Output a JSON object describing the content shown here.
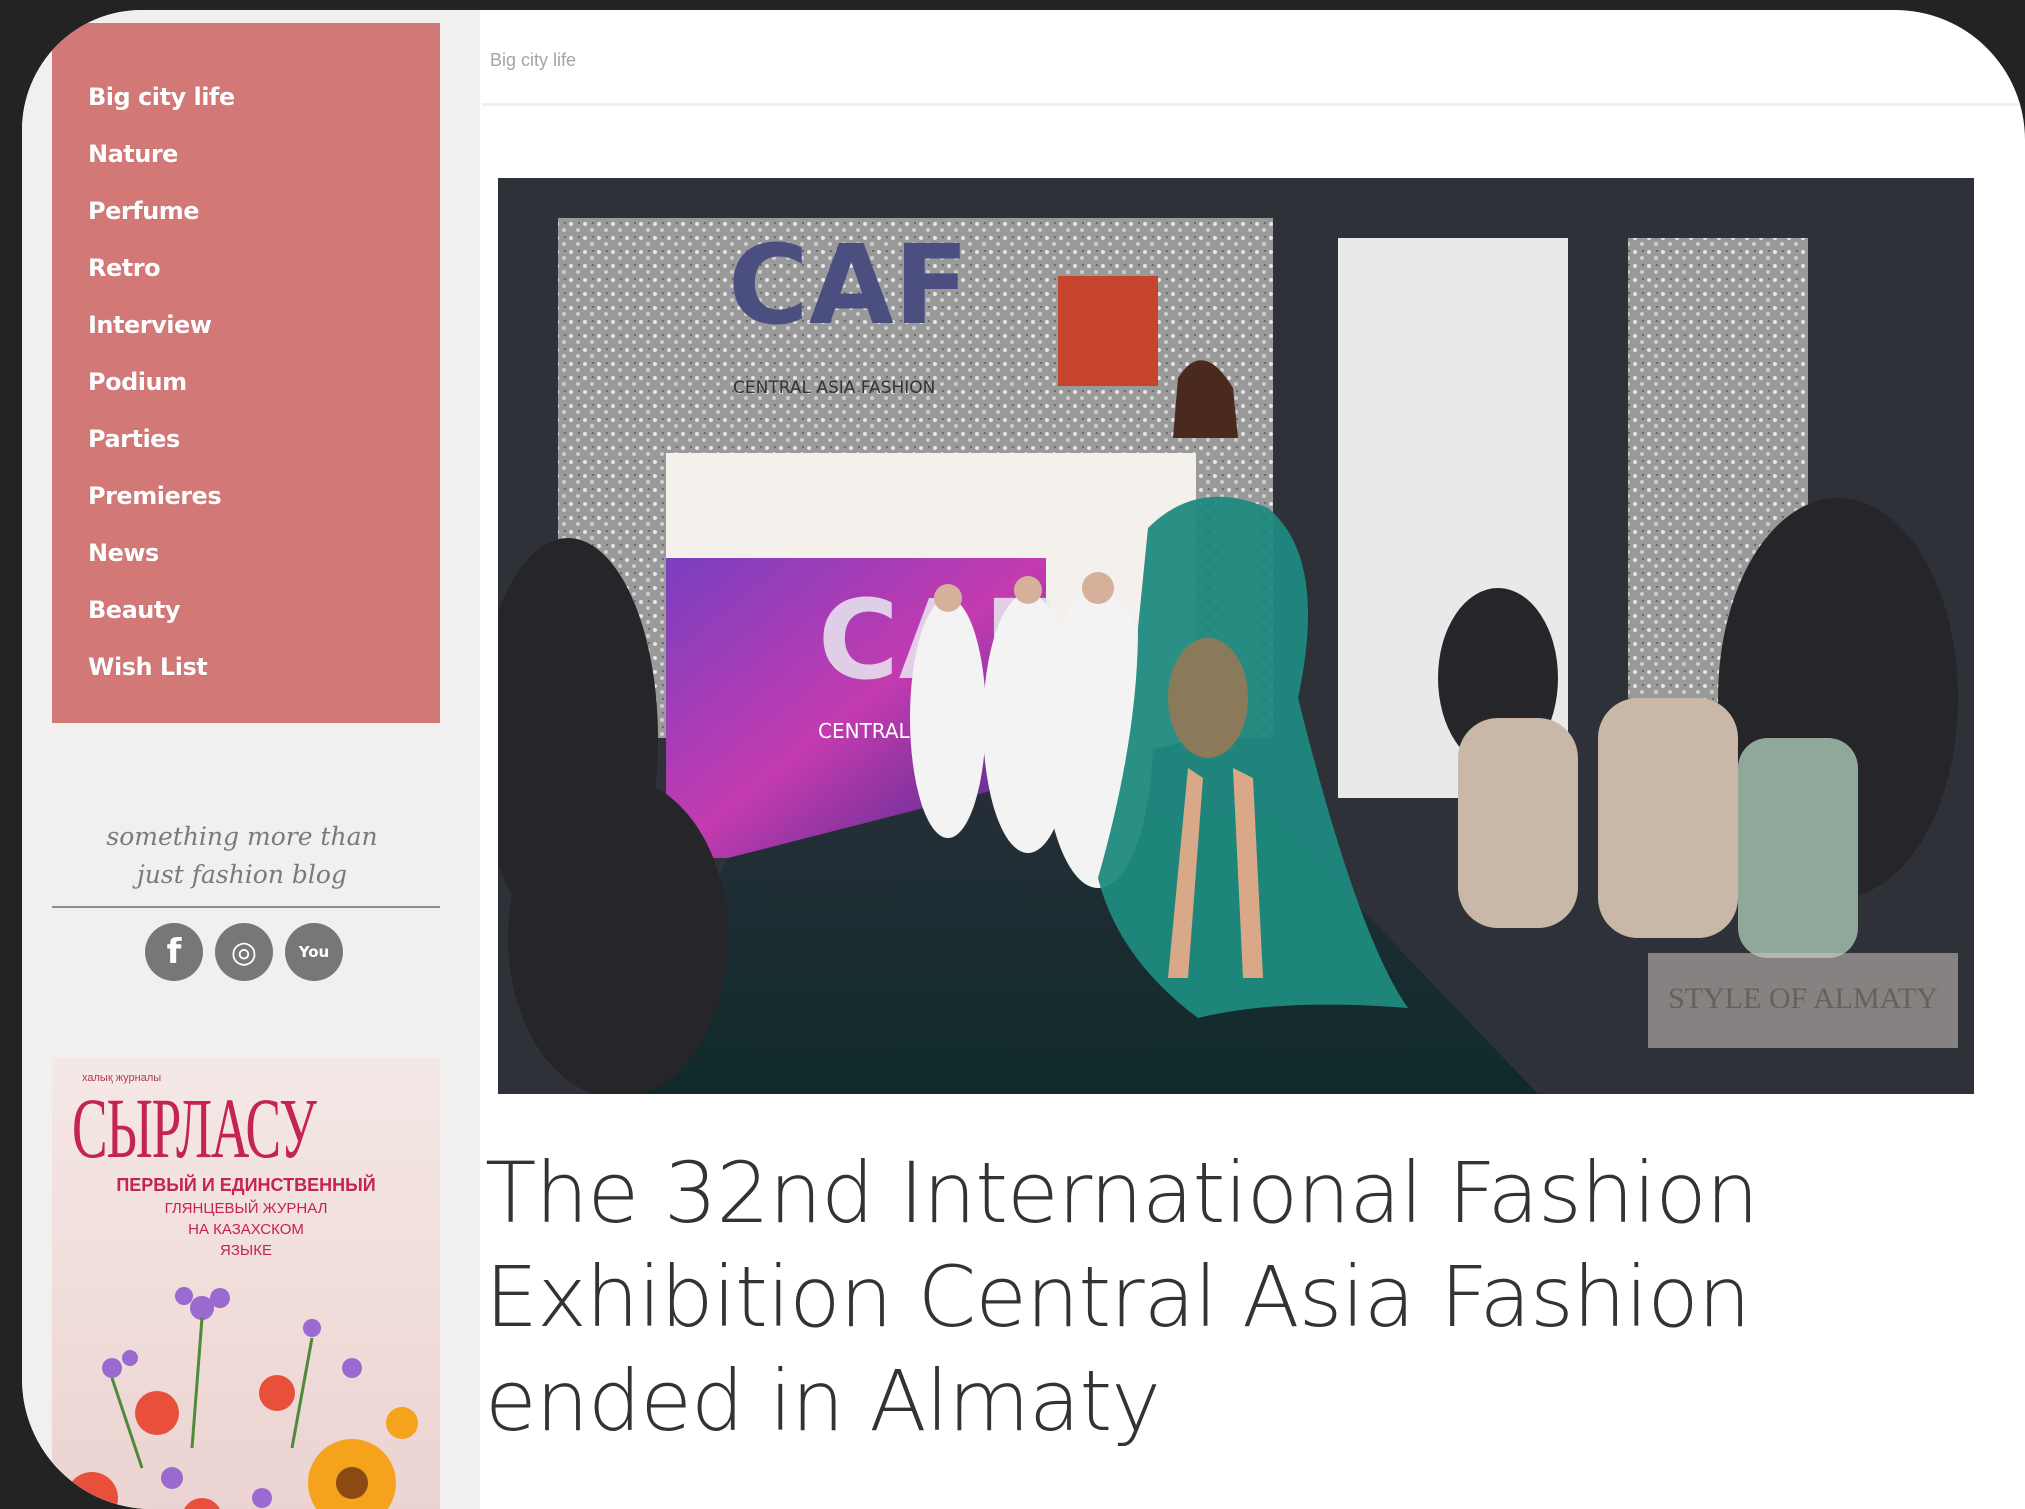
{
  "sidebar": {
    "nav_items": [
      "Big city life",
      "Nature",
      "Perfume",
      "Retro",
      "Interview",
      "Podium",
      "Parties",
      "Premieres",
      "News",
      "Beauty",
      "Wish List"
    ],
    "tagline_line1": "something more than",
    "tagline_line2": "just fashion blog",
    "social": [
      {
        "icon": "facebook-icon",
        "glyph": "f"
      },
      {
        "icon": "instagram-icon",
        "glyph": "◎"
      },
      {
        "icon": "youtube-icon",
        "glyph": "You"
      }
    ]
  },
  "ad": {
    "top_text": "халық журналы",
    "title": "СЫРЛАСУ",
    "subtitle": "ПЕРВЫЙ И ЕДИНСТВЕННЫЙ",
    "line1": "ГЛЯНЦЕВЫЙ ЖУРНАЛ",
    "line2": "НА КАЗАХСКОМ",
    "line3": "ЯЗЫКЕ"
  },
  "breadcrumb": "Big city life",
  "hero": {
    "logo_text": "CAF",
    "logo_sub": "CENTRAL ASIA FASHION",
    "screen_logo": "CAF",
    "screen_sub": "CENTRAL",
    "watermark": "STYLE OF ALMATY"
  },
  "article": {
    "title": "The 32nd International Fashion Exhibition Central Asia Fashion ended in Almaty"
  },
  "colors": {
    "accent": "#d27876",
    "ad_red": "#c4244d",
    "dress_green": "#1f8a80"
  }
}
